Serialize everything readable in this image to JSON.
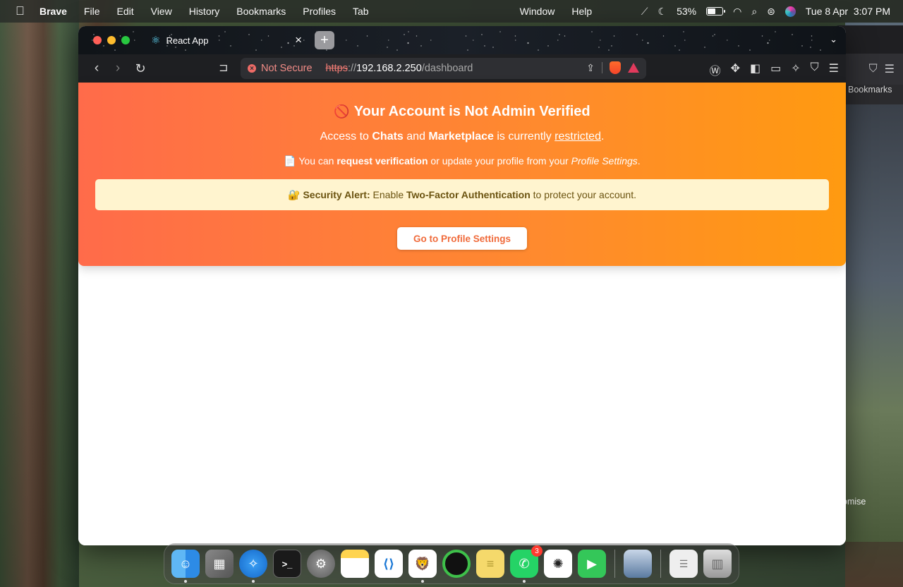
{
  "menubar": {
    "app_name": "Brave",
    "items": [
      "File",
      "Edit",
      "View",
      "History",
      "Bookmarks",
      "Profiles",
      "Tab",
      "Window",
      "Help"
    ],
    "battery": "53%",
    "battery_level": 0.53,
    "datetime": "Tue 8 Apr  3:07 PM"
  },
  "browser": {
    "tab_title": "React App",
    "url": {
      "security_label": "Not Secure",
      "scheme": "https",
      "separator": "://",
      "host": "192.168.2.250",
      "path": "/dashboard"
    }
  },
  "background_window": {
    "bookmarks_label": "Bookmarks",
    "partial_text": "omise"
  },
  "banner": {
    "title_icon": "🚫",
    "title": "Your Account is Not Admin Verified",
    "line1": {
      "prefix": "Access to ",
      "chats": "Chats",
      "and": " and ",
      "marketplace": "Marketplace",
      "middle": " is currently ",
      "restricted": "restricted",
      "suffix": "."
    },
    "line2": {
      "icon": "📄",
      "prefix": " You can ",
      "request": "request verification",
      "middle": " or update your profile from your ",
      "settings": "Profile Settings",
      "suffix": "."
    },
    "alert": {
      "icon": "🔐",
      "label": "Security Alert:",
      "prefix": " Enable ",
      "tfa": "Two-Factor Authentication",
      "suffix": " to protect your account."
    },
    "button_label": "Go to Profile Settings"
  },
  "dock": {
    "apps": [
      "Finder",
      "Launchpad",
      "Safari",
      "Terminal",
      "System Settings",
      "Notes",
      "Visual Studio Code",
      "Brave Browser",
      "Activity",
      "Stickies",
      "WhatsApp",
      "ChatGPT",
      "FaceTime",
      "Preview",
      "Documents",
      "Trash"
    ],
    "whatsapp_badge": "3"
  },
  "colors": {
    "banner_start": "#ff6b4a",
    "banner_end": "#ff9a10",
    "alert_bg": "#fff4cf",
    "alert_text": "#6b5310",
    "button_text": "#f06a3a",
    "not_secure": "#f08b86"
  }
}
